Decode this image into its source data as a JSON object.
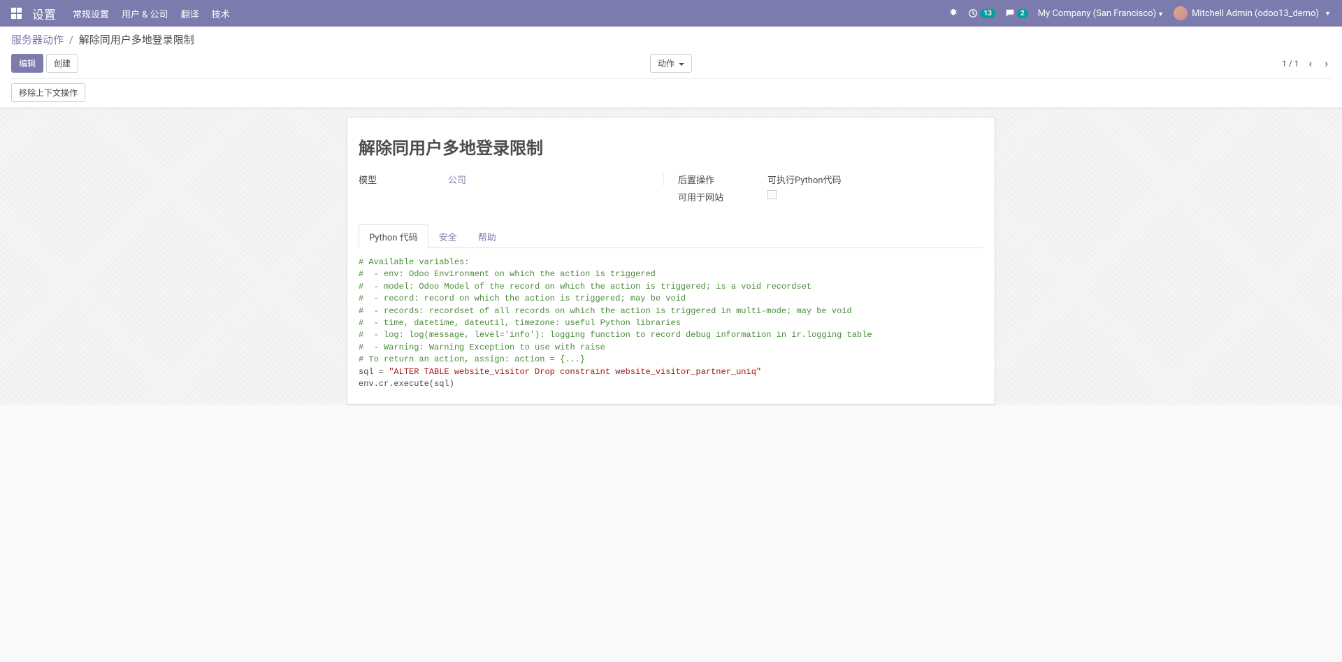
{
  "topnav": {
    "brand": "设置",
    "menu": [
      "常规设置",
      "用户 & 公司",
      "翻译",
      "技术"
    ],
    "activities_badge": "13",
    "discuss_badge": "2",
    "company": "My Company (San Francisco)",
    "user": "Mitchell Admin (odoo13_demo)"
  },
  "breadcrumb": {
    "parent": "服务器动作",
    "current": "解除同用户多地登录限制"
  },
  "cp": {
    "edit": "编辑",
    "create": "创建",
    "action": "动作",
    "pager": "1 / 1",
    "remove_ctx": "移除上下文操作"
  },
  "form": {
    "title": "解除同用户多地登录限制",
    "l_model": "模型",
    "v_model": "公司",
    "l_after": "后置操作",
    "v_after": "可执行Python代码",
    "l_website": "可用于网站"
  },
  "tabs": {
    "code": "Python 代码",
    "security": "安全",
    "help": "帮助"
  },
  "code": {
    "c1": "# Available variables:",
    "c2": "#  - env: Odoo Environment on which the action is triggered",
    "c3": "#  - model: Odoo Model of the record on which the action is triggered; is a void recordset",
    "c4": "#  - record: record on which the action is triggered; may be void",
    "c5": "#  - records: recordset of all records on which the action is triggered in multi-mode; may be void",
    "c6": "#  - time, datetime, dateutil, timezone: useful Python libraries",
    "c7": "#  - log: log(message, level='info'): logging function to record debug information in ir.logging table",
    "c8": "#  - Warning: Warning Exception to use with raise",
    "c9": "# To return an action, assign: action = {...}",
    "l1a": "sql = ",
    "l1s": "\"ALTER TABLE website_visitor Drop constraint website_visitor_partner_uniq\"",
    "l2": "env.cr.execute(sql)"
  }
}
